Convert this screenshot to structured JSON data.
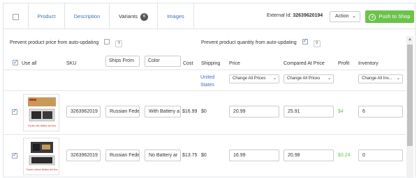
{
  "tabs": [
    {
      "label": "Product"
    },
    {
      "label": "Description"
    },
    {
      "label": "Variants",
      "badge": "6"
    },
    {
      "label": "Images"
    }
  ],
  "header": {
    "external_id_label": "External Id:",
    "external_id": "32639620194",
    "action_label": "Action",
    "push_label": "Push to Shop"
  },
  "options": {
    "prevent_price": "Prevent product price from auto-updating",
    "prevent_quantity": "Prevent product quantity from auto-updating",
    "help": "?"
  },
  "columns": {
    "use_all": "Use all",
    "sku": "SKU",
    "ships_from": "Ships From",
    "color": "Color",
    "cost": "Cost",
    "shipping": "Shipping",
    "price": "Price",
    "compare_at_price": "Compared At Price",
    "profit": "Profit",
    "inventory": "Inventory"
  },
  "bulk": {
    "shipping_country": "United States",
    "change_prices": "Change All Prices",
    "change_inventory": "Change All Inv..."
  },
  "rows": [
    {
      "checked": true,
      "sku": "3263962019",
      "ships_from": "Russian Fede",
      "color": "With Battery a",
      "cost": "$16.99",
      "shipping": "$0",
      "price": "20.99",
      "compare_at": "25.91",
      "profit": "$4",
      "inventory": "6",
      "thumb_caption": "Tracker with Battery and Box"
    },
    {
      "checked": true,
      "sku": "3263962019",
      "ships_from": "Russian Fede",
      "color": "No Battery ar",
      "cost": "$13.75",
      "shipping": "$0",
      "price": "16.99",
      "compare_at": "20.98",
      "profit": "$3.24",
      "inventory": "0",
      "thumb_caption": "Tracker without Battery and Box"
    }
  ],
  "colors": {
    "link": "#3d72b8",
    "accent_green": "#6cc24a",
    "border": "#c8ccd1"
  }
}
